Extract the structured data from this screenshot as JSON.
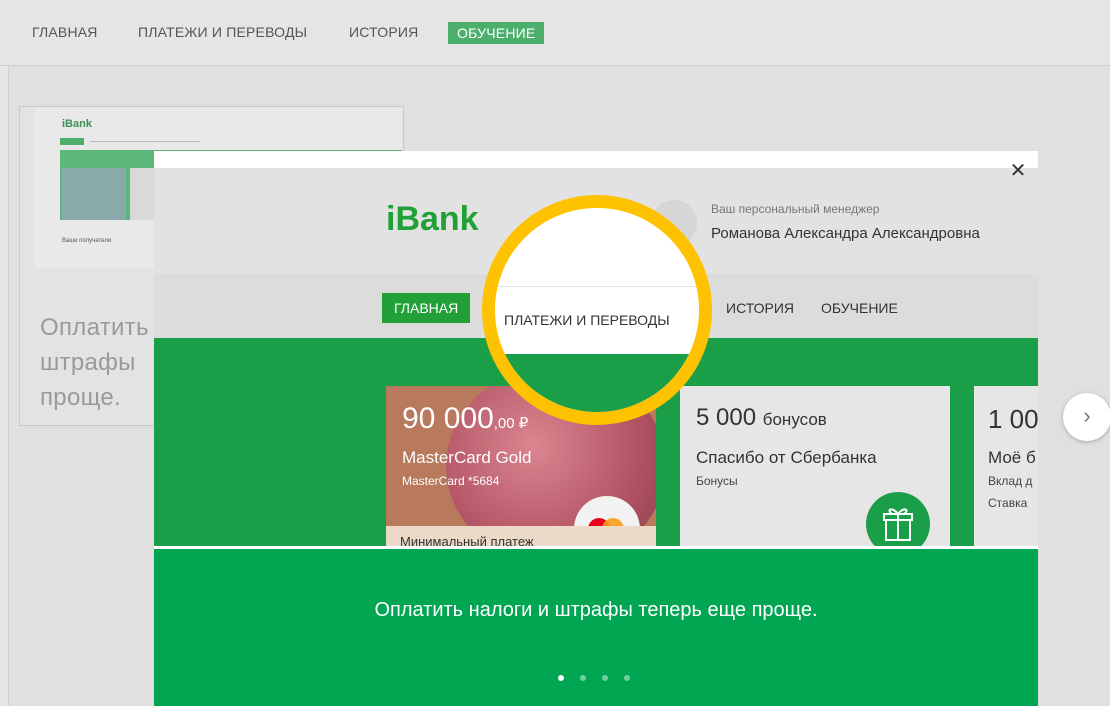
{
  "topnav": {
    "items": [
      "ГЛАВНАЯ",
      "ПЛАТЕЖИ И ПЕРЕВОДЫ",
      "ИСТОРИЯ",
      "ОБУЧЕНИЕ"
    ],
    "active_index": 3
  },
  "background": {
    "thumb_logo": "iBank",
    "thumb_recipients": "Ваши получатели",
    "caption_lines": [
      "Оплатить",
      "штрафы",
      "проще."
    ]
  },
  "modal": {
    "close_icon": "close-icon",
    "screen": {
      "logo": "iBank",
      "manager_label": "Ваш персональный менеджер",
      "manager_name": "Романова Александра Александровна",
      "menu": [
        "ГЛАВНАЯ",
        "ПЛАТЕЖИ И ПЕРЕВОДЫ",
        "ИСТОРИЯ",
        "ОБУЧЕНИЕ"
      ],
      "card1": {
        "amount_main": "90 000",
        "amount_cents": ",00 ₽",
        "name": "MasterCard Gold",
        "sub": "MasterCard *5684",
        "min_payment": "Минимальный платеж"
      },
      "card2": {
        "amount": "5 000",
        "unit": "бонусов",
        "title": "Спасибо от Сбербанка",
        "sub": "Бонусы"
      },
      "card3": {
        "amount": "1 00",
        "title": "Моё б",
        "sub": "Вклад д",
        "rate": "Ставка"
      }
    },
    "footer_text": "Оплатить налоги и штрафы теперь еще проще.",
    "dots_total": 4,
    "dots_active": 0
  },
  "next_button_icon": "chevron-right-icon",
  "colors": {
    "brand_green": "#21a038",
    "footer_green": "#00a651",
    "highlight_yellow": "#ffc200"
  }
}
